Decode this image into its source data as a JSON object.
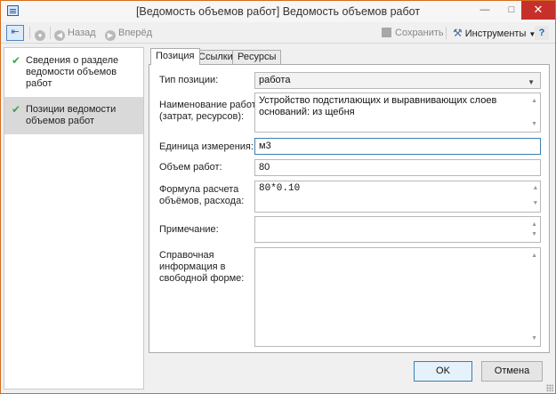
{
  "window": {
    "title": "[Ведомость объемов работ] Ведомость объемов работ",
    "accent": "#d46e1f"
  },
  "toolbar": {
    "back_label": "Назад",
    "forward_label": "Вперёд",
    "save_label": "Сохранить",
    "tools_label": "Инструменты",
    "help_label": "?"
  },
  "nav": {
    "items": [
      {
        "label": "Сведения о разделе ведомости объемов работ",
        "selected": false
      },
      {
        "label": "Позиции ведомости объемов работ",
        "selected": true
      }
    ]
  },
  "tabs": [
    {
      "label": "Позиция",
      "active": true
    },
    {
      "label": "Ссылки",
      "active": false
    },
    {
      "label": "Ресурсы",
      "active": false
    }
  ],
  "form": {
    "type_label": "Тип позиции:",
    "type_value": "работа",
    "name_label": "Наименование работ (затрат, ресурсов):",
    "name_value": "Устройство подстилающих и выравнивающих слоев оснований: из щебня",
    "unit_label": "Единица измерения:",
    "unit_value": "м3",
    "volume_label": "Объем работ:",
    "volume_value": "80",
    "formula_label": "Формула расчета объёмов, расхода:",
    "formula_value": "80*0.10",
    "note_label": "Примечание:",
    "note_value": "",
    "info_label": "Справочная информация в свободной форме:",
    "info_value": ""
  },
  "buttons": {
    "ok_label": "OK",
    "cancel_label": "Отмена"
  }
}
